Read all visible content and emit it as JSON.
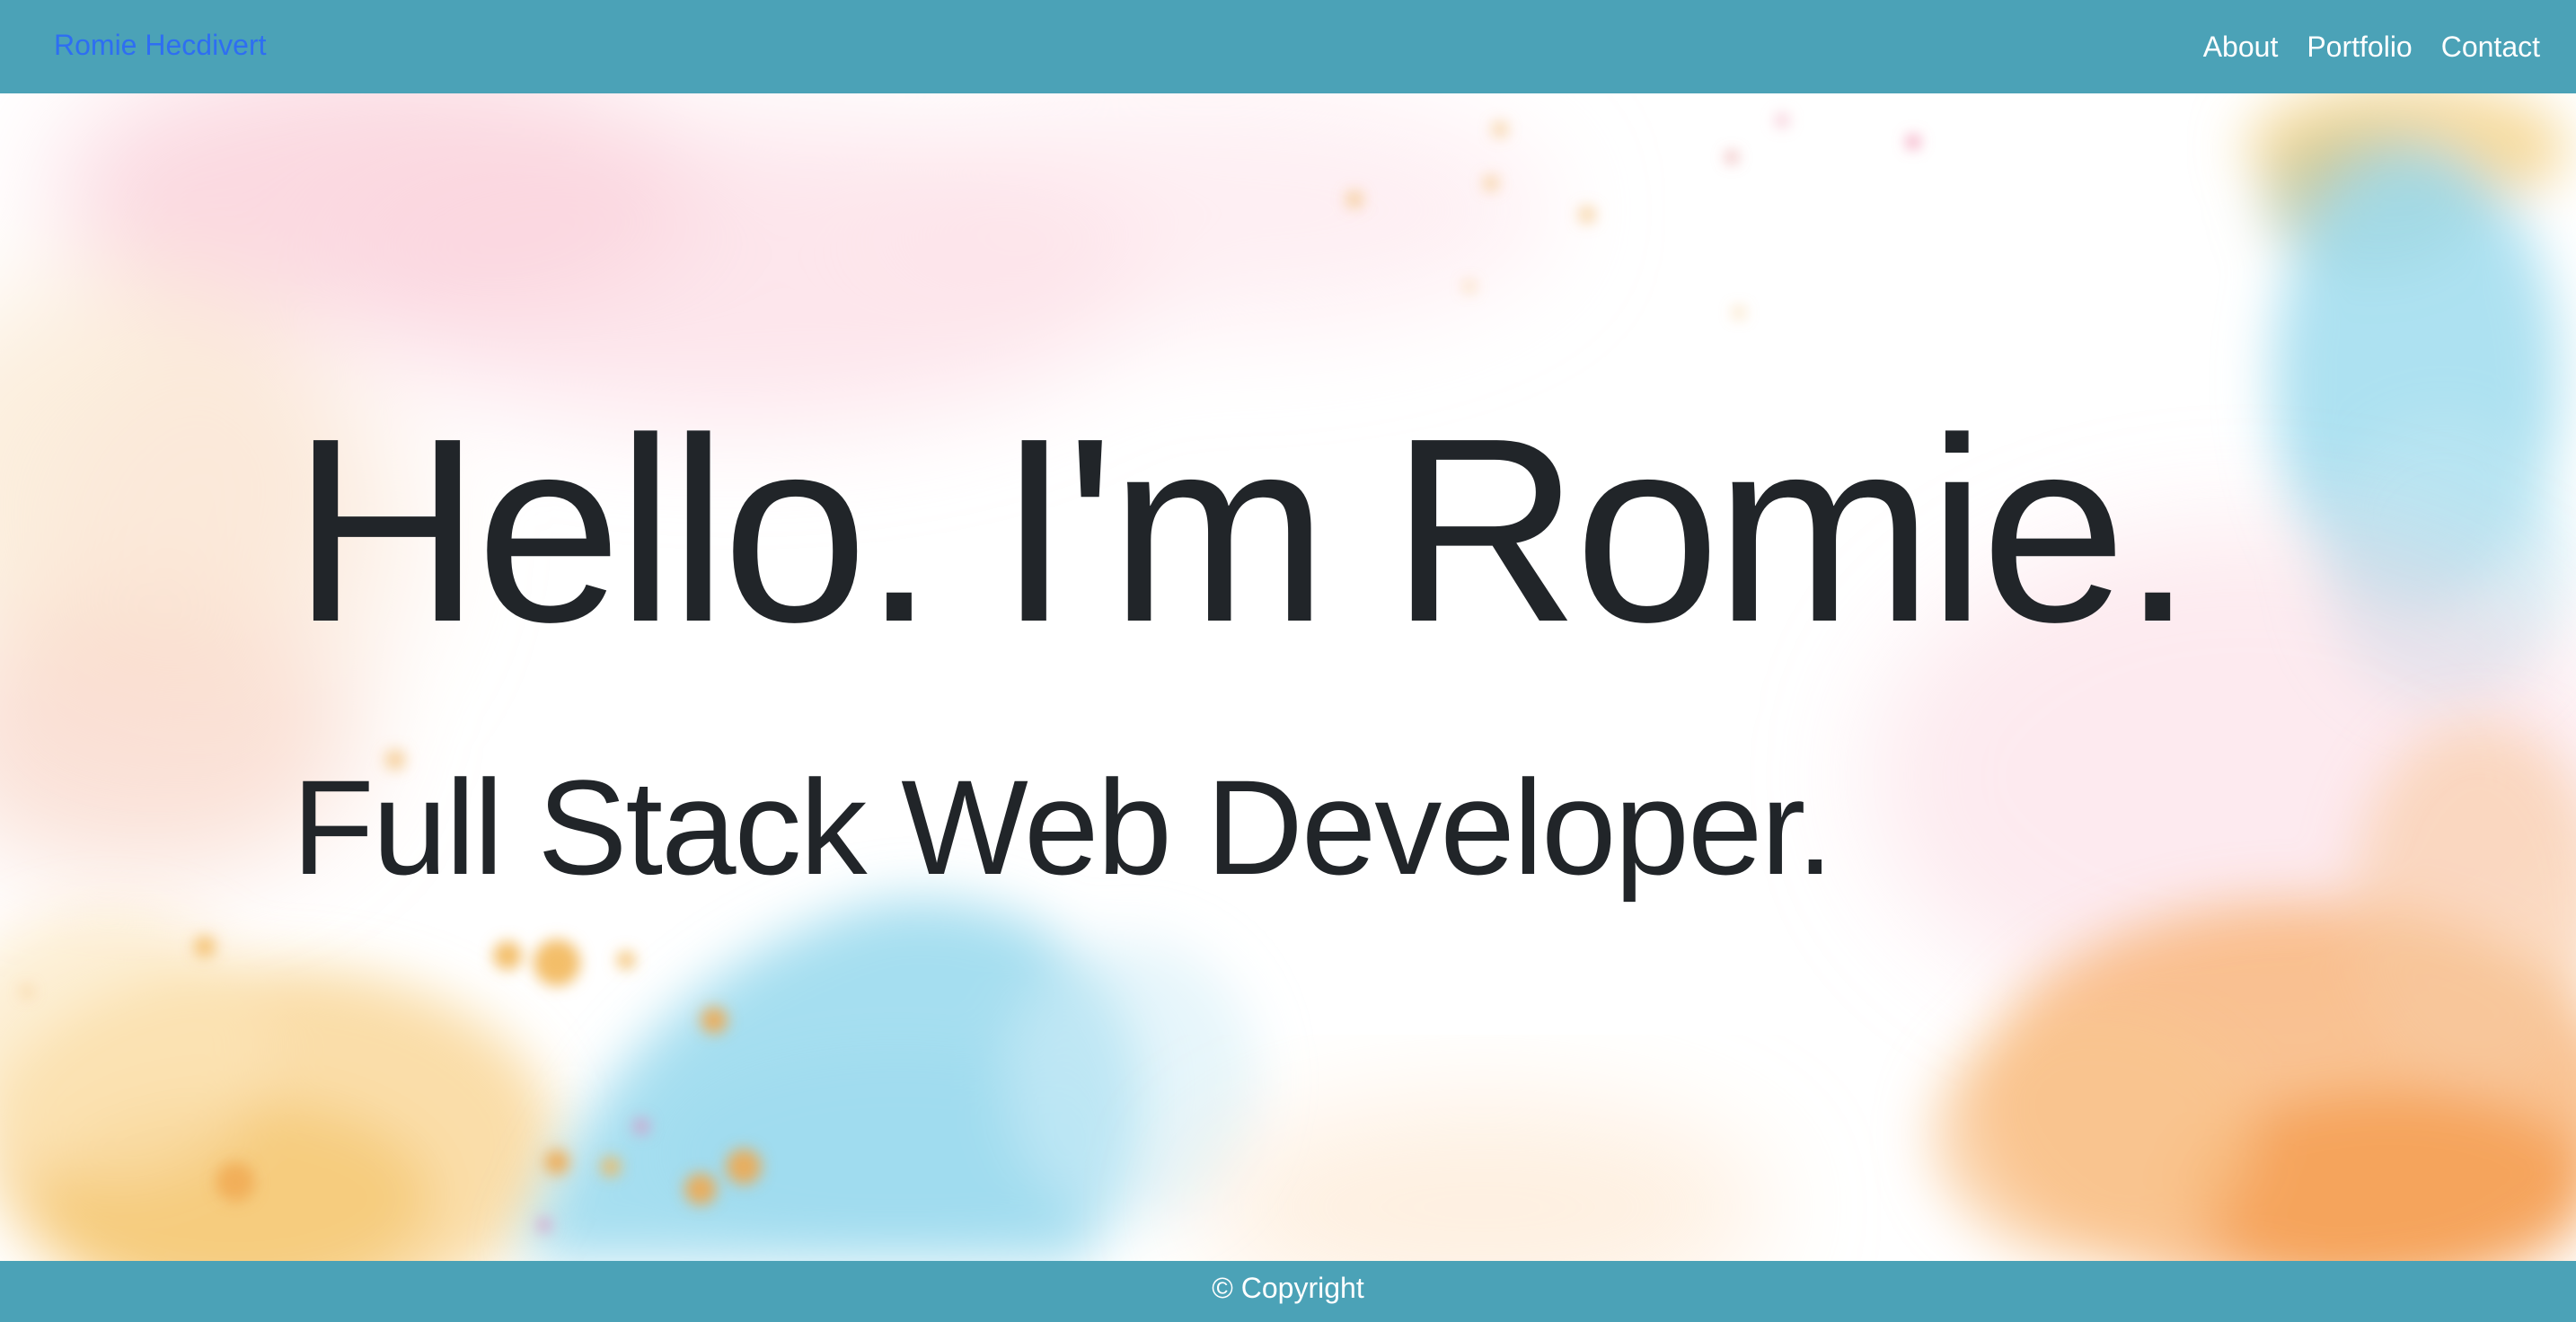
{
  "navbar": {
    "brand": "Romie Hecdivert",
    "brand_color": "#2e6ef2",
    "links": [
      "About",
      "Portfolio",
      "Contact"
    ],
    "background": "#4ba2b7"
  },
  "hero": {
    "title": "Hello. I'm Romie.",
    "subtitle": "Full Stack Web Developer.",
    "background_style": "watercolor splashes"
  },
  "footer": {
    "copyright": "© Copyright"
  }
}
